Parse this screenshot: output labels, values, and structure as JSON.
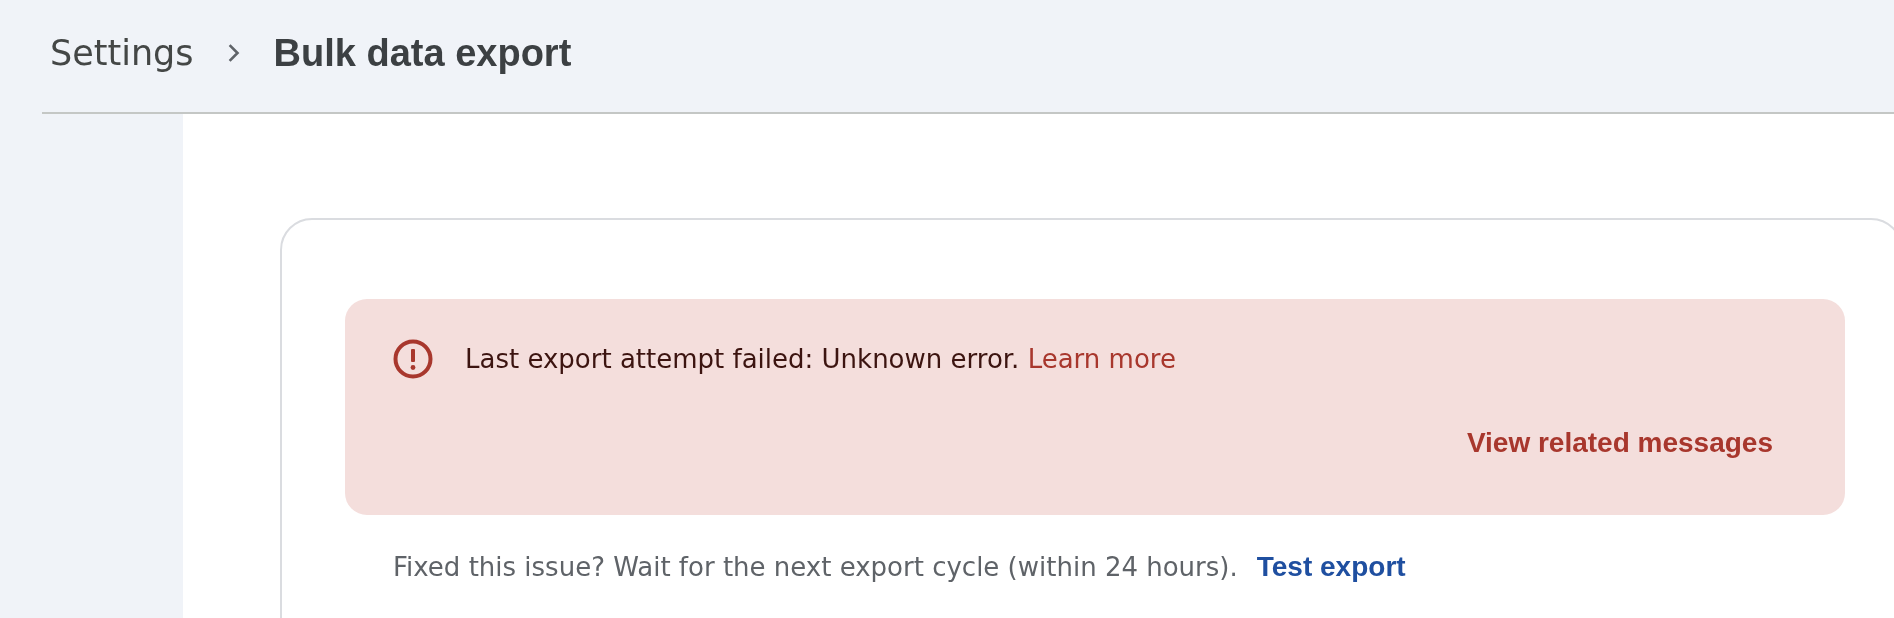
{
  "breadcrumb": [
    {
      "label": "Settings",
      "current": false
    },
    {
      "label": "Bulk data export",
      "current": true
    }
  ],
  "error_banner": {
    "message": "Last export attempt failed: Unknown error.",
    "link": "Learn more",
    "action": "View related messages"
  },
  "footer_note": {
    "text": "Fixed this issue? Wait for the next export cycle (within 24 hours).",
    "link": "Test export"
  }
}
